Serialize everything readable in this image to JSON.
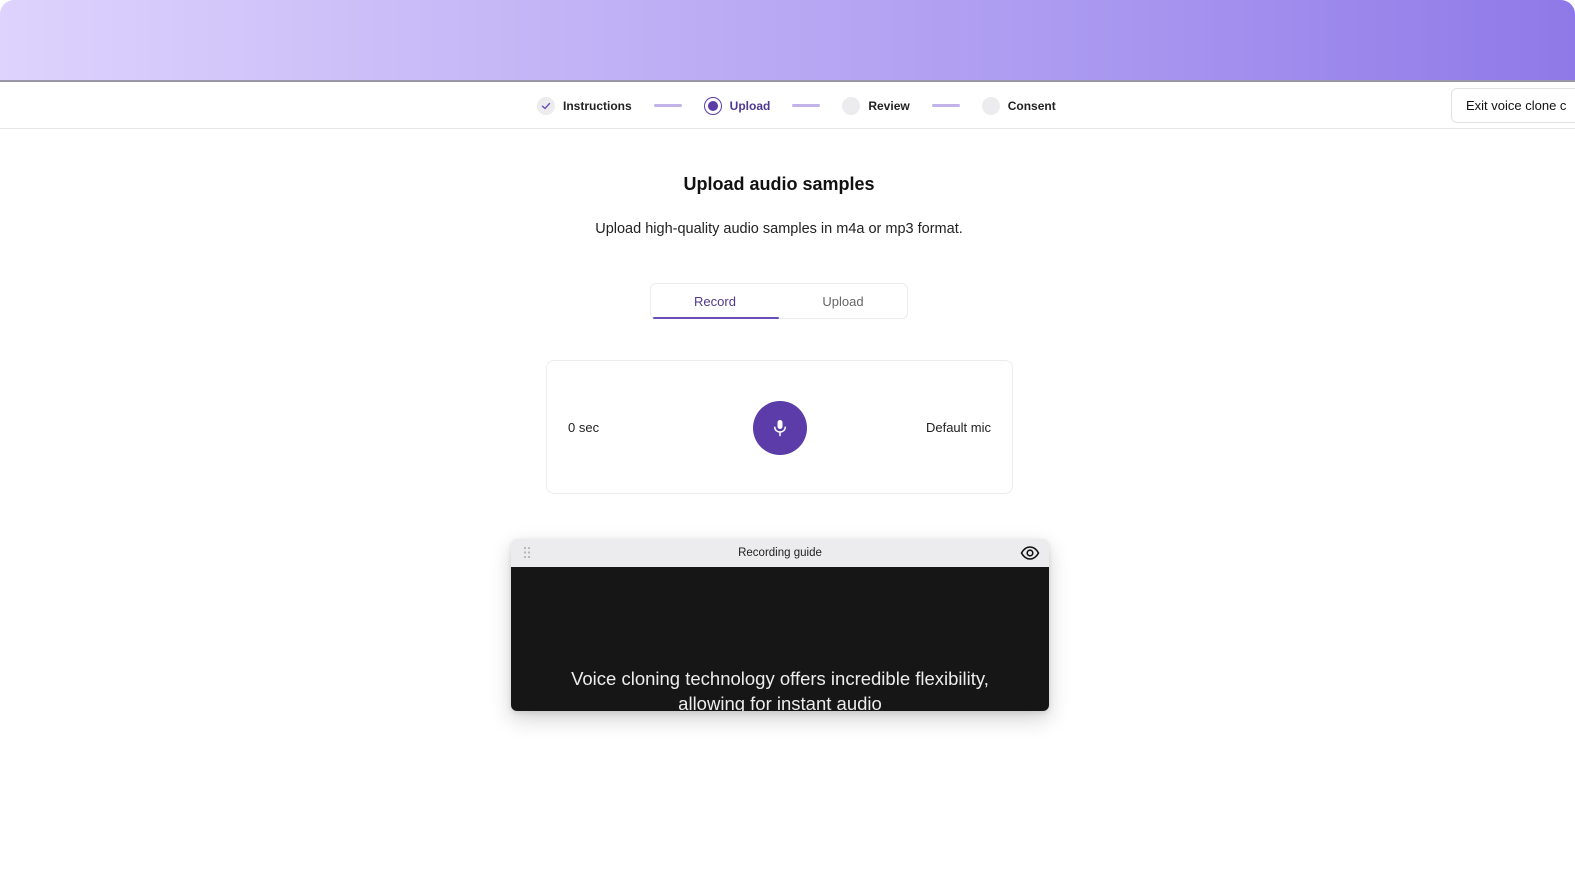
{
  "stepper": {
    "steps": [
      {
        "label": "Instructions",
        "state": "done"
      },
      {
        "label": "Upload",
        "state": "active"
      },
      {
        "label": "Review",
        "state": "pending"
      },
      {
        "label": "Consent",
        "state": "pending"
      }
    ]
  },
  "header": {
    "exit_label": "Exit voice clone c"
  },
  "main": {
    "title": "Upload audio samples",
    "subtitle": "Upload high-quality audio samples in m4a or mp3 format.",
    "tabs": [
      {
        "label": "Record",
        "active": true
      },
      {
        "label": "Upload",
        "active": false
      }
    ]
  },
  "recorder": {
    "elapsed": "0 sec",
    "mic_icon": "microphone-icon",
    "device": "Default mic"
  },
  "guide": {
    "title": "Recording guide",
    "text": "Voice cloning technology offers incredible flexibility, allowing for instant audio"
  },
  "colors": {
    "accent": "#5b3ca8",
    "accent_text": "#4e3a8f",
    "connector": "#c2b2ea",
    "guide_bg": "#161616"
  }
}
